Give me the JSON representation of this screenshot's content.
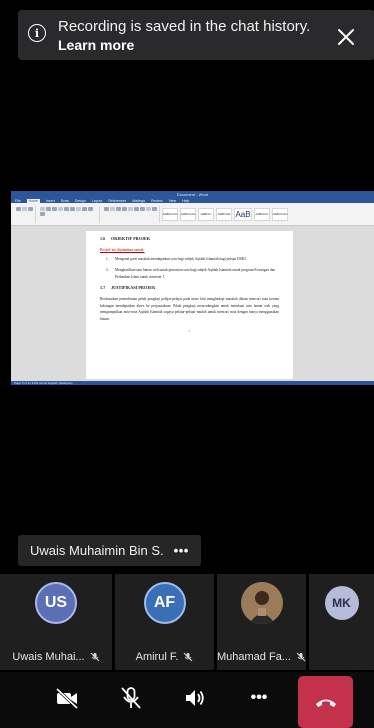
{
  "banner": {
    "message": "Recording is saved in the chat history.",
    "link": "Learn more",
    "info_icon": "i"
  },
  "shared_doc": {
    "heading1_num": "1.6",
    "heading1": "OBJEKTIF PROJEK",
    "subheading": "Projek ini dijalankan untuk:",
    "items": [
      {
        "num": "1.",
        "text": "Mengenal pasti masalah mendapatkan sotu bagi subjek Aqidah Islamiah bagi pelajar DSKI."
      },
      {
        "num": "2.",
        "text": "Menghasilkan satu laman web untuk pencarian sotu bagi subjek Aqidah Islamiah untuk program Kevangan dan Perbankan Islam untuk semester 1."
      }
    ],
    "heading2_num": "1.7",
    "heading2": "JUSTIFIKASI PROJEK",
    "paragraph": "Berdasarkan pemerhatian pihak pengkaji pelajar-pelajar pada masa kini menghadapi masalah dalam mencari nota kerana kekangan mendapatkan akses ke perpustakaan. Pihak pengkaji mencadangkan untuk membuat satu laman web yang mengumpulkan nota-nota Aqidah Islamiah supaya pelajar-pelajar mudah untuk mencari nota dengan hanya menggunakan laman.",
    "page_number": "5",
    "window_title": "Document - Word",
    "tabs": [
      "File",
      "Home",
      "Insert",
      "Draw",
      "Design",
      "Layout",
      "References",
      "Mailings",
      "Review",
      "View",
      "Help"
    ],
    "styles": [
      "AaBbCcDc",
      "AaBbCcDc",
      "AaBbCc",
      "AaBbCcE",
      "AaB",
      "AaBbCcC",
      "AaBbCcDc"
    ],
    "status": "Page 5 of 11   2345 words   English (Malaysia)"
  },
  "presenter": {
    "name": "Uwais Muhaimin Bin S.",
    "more": "•••"
  },
  "participants": [
    {
      "initials": "US",
      "label": "Uwais Muhai...",
      "color": "#5b6fb5",
      "muted": true
    },
    {
      "initials": "AF",
      "label": "Amirul F.",
      "color": "#3a6fb5",
      "muted": true
    },
    {
      "initials": "",
      "label": "Muhamad Fa...",
      "color": "#8a6a4e",
      "muted": true
    },
    {
      "initials": "MK",
      "label": "",
      "color": "#b6bbd9",
      "muted": false
    }
  ],
  "controls": {
    "camera": "camera-off-icon",
    "mic": "mic-off-icon",
    "speaker": "speaker-icon",
    "more": "•••",
    "hangup": "hang-up-icon"
  },
  "colors": {
    "hangup": "#c4314b",
    "word_blue": "#2b579a",
    "heading_red": "#c00000"
  }
}
